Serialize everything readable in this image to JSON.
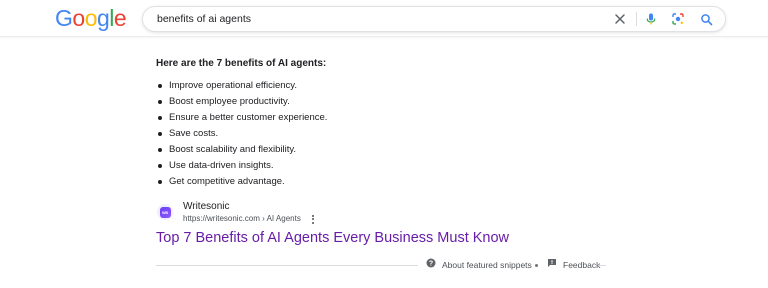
{
  "logo": {
    "letters": [
      "G",
      "o",
      "o",
      "g",
      "l",
      "e"
    ],
    "colors": [
      "#4285F4",
      "#EA4335",
      "#FBBC05",
      "#4285F4",
      "#34A853",
      "#EA4335"
    ]
  },
  "search": {
    "query": "benefits of ai agents",
    "icons": [
      "close-icon",
      "microphone-icon",
      "lens-icon",
      "search-icon"
    ]
  },
  "snippet": {
    "heading": "Here are the 7 benefits of AI agents:",
    "items": [
      "Improve operational efficiency.",
      "Boost employee productivity.",
      "Ensure a better customer experience.",
      "Save costs.",
      "Boost scalability and flexibility.",
      "Use data-driven insights.",
      "Get competitive advantage."
    ]
  },
  "source": {
    "favicon_text": "WS",
    "site_name": "Writesonic",
    "url": "https://writesonic.com › AI Agents",
    "title": "Top 7 Benefits of AI Agents Every Business Must Know",
    "title_color": "#681da8"
  },
  "footer": {
    "about": "About featured snippets",
    "feedback": "Feedback"
  }
}
